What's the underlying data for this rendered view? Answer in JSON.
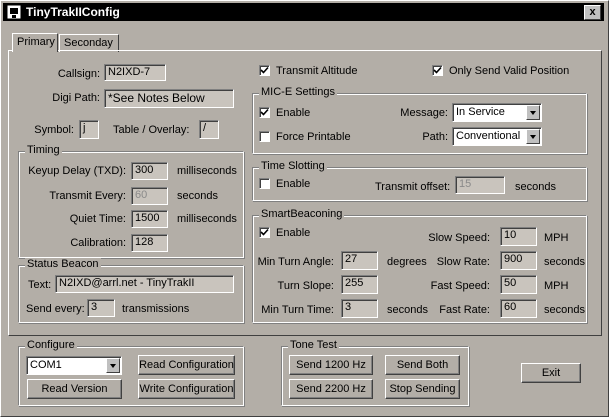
{
  "window": {
    "title": "TinyTrakIIConfig",
    "close_glyph": "x"
  },
  "tabs": [
    {
      "label": "Primary",
      "active": true
    },
    {
      "label": "Seconday",
      "active": false
    }
  ],
  "primary": {
    "callsign_label": "Callsign:",
    "callsign_value": "N2IXD-7",
    "digipath_label": "Digi Path:",
    "digipath_value": "*See Notes Below",
    "symbol_label": "Symbol:",
    "symbol_value": "j",
    "table_label": "Table / Overlay:",
    "table_value": "/",
    "transmit_altitude_label": "Transmit Altitude",
    "transmit_altitude_checked": true,
    "valid_position_label": "Only Send Valid Position",
    "valid_position_checked": true
  },
  "timing": {
    "title": "Timing",
    "keyup_label": "Keyup Delay (TXD):",
    "keyup_value": "300",
    "keyup_unit": "milliseconds",
    "transmit_every_label": "Transmit Every:",
    "transmit_every_value": "60",
    "transmit_every_unit": "seconds",
    "quiet_label": "Quiet Time:",
    "quiet_value": "1500",
    "quiet_unit": "milliseconds",
    "calibration_label": "Calibration:",
    "calibration_value": "128"
  },
  "status_beacon": {
    "title": "Status Beacon",
    "text_label": "Text:",
    "text_value": "N2IXD@arrl.net - TinyTrakII",
    "send_every_label": "Send every:",
    "send_every_value": "3",
    "send_every_unit": "transmissions"
  },
  "mice": {
    "title": "MIC-E Settings",
    "enable_label": "Enable",
    "enable_checked": true,
    "force_label": "Force Printable",
    "force_checked": false,
    "message_label": "Message:",
    "message_value": "In Service",
    "path_label": "Path:",
    "path_value": "Conventional"
  },
  "time_slotting": {
    "title": "Time Slotting",
    "enable_label": "Enable",
    "enable_checked": false,
    "offset_label": "Transmit offset:",
    "offset_value": "15",
    "offset_unit": "seconds"
  },
  "smartbeaconing": {
    "title": "SmartBeaconing",
    "enable_label": "Enable",
    "enable_checked": true,
    "min_turn_angle_label": "Min Turn Angle:",
    "min_turn_angle_value": "27",
    "min_turn_angle_unit": "degrees",
    "turn_slope_label": "Turn Slope:",
    "turn_slope_value": "255",
    "min_turn_time_label": "Min Turn Time:",
    "min_turn_time_value": "3",
    "min_turn_time_unit": "seconds",
    "slow_speed_label": "Slow Speed:",
    "slow_speed_value": "10",
    "slow_speed_unit": "MPH",
    "slow_rate_label": "Slow Rate:",
    "slow_rate_value": "900",
    "slow_rate_unit": "seconds",
    "fast_speed_label": "Fast Speed:",
    "fast_speed_value": "50",
    "fast_speed_unit": "MPH",
    "fast_rate_label": "Fast Rate:",
    "fast_rate_value": "60",
    "fast_rate_unit": "seconds"
  },
  "configure": {
    "title": "Configure",
    "port_value": "COM1",
    "read_config": "Read Configuration",
    "read_version": "Read Version",
    "write_config": "Write Configuration"
  },
  "tone_test": {
    "title": "Tone Test",
    "send1200": "Send 1200 Hz",
    "send_both": "Send Both",
    "send2200": "Send 2200 Hz",
    "stop": "Stop Sending"
  },
  "exit_label": "Exit"
}
